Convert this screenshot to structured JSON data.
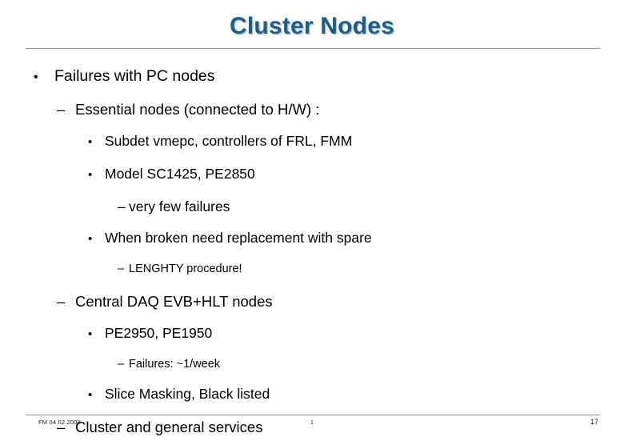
{
  "slide": {
    "title": "Cluster Nodes",
    "bullets": [
      {
        "level": 1,
        "marker": "•",
        "text": "Failures with PC nodes"
      },
      {
        "level": 2,
        "marker": "–",
        "text": "Essential nodes (connected to H/W) :"
      },
      {
        "level": 3,
        "marker": "•",
        "text": "Subdet vmepc, controllers of FRL, FMM"
      },
      {
        "level": 3,
        "marker": "•",
        "text": "Model SC1425, PE2850"
      },
      {
        "level": 4,
        "marker": "–",
        "text": "very few failures"
      },
      {
        "level": 3,
        "marker": "•",
        "text": "When broken need replacement with spare"
      },
      {
        "level": 5,
        "marker": "–",
        "text": "LENGHTY procedure!"
      },
      {
        "level": 2,
        "marker": "–",
        "text": "Central DAQ EVB+HLT nodes"
      },
      {
        "level": 3,
        "marker": "•",
        "text": "PE2950, PE1950"
      },
      {
        "level": 5,
        "marker": "–",
        "text": "Failures: ~1/week"
      },
      {
        "level": 3,
        "marker": "•",
        "text": "Slice Masking, Black listed"
      },
      {
        "level": 2,
        "marker": "–",
        "text": "Cluster and general services"
      }
    ]
  },
  "footer": {
    "left": "FM 04.02.2009",
    "center": "1",
    "right": "17"
  },
  "colors": {
    "title": "#1f5c87",
    "rule": "#8d8d8d",
    "body_text": "#000000",
    "background": "#ffffff"
  }
}
